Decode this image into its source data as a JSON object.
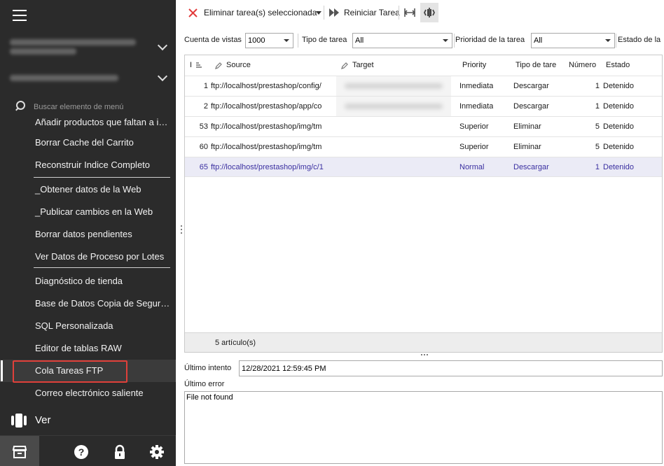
{
  "sidebar": {
    "search_placeholder": "Buscar elemento de menú",
    "menu_items": [
      "Añadir productos que faltan a inici",
      "Borrar Cache del Carrito",
      "Reconstruir Indice Completo",
      "_Obtener datos de la Web",
      "_Publicar cambios en la Web",
      "Borrar datos pendientes",
      "Ver Datos de Proceso por Lotes",
      "Diagnóstico de tienda",
      "Base de Datos Copia de Seguridad",
      "SQL Personalizada",
      "Editor de tablas RAW",
      "Cola Tareas FTP",
      "Correo electrónico saliente"
    ],
    "selected_item": "Cola Tareas FTP",
    "ver_label": "Ver",
    "bottom_icons": [
      "store-icon",
      "help-icon",
      "lock-icon",
      "gear-icon"
    ]
  },
  "toolbar": {
    "delete_label": "Eliminar tarea(s) seleccionada",
    "restart_label": "Reiniciar Tarea"
  },
  "filters": {
    "views_label": "Cuenta de vistas",
    "views_value": "1000",
    "task_type_label": "Tipo de tarea",
    "task_type_value": "All",
    "priority_label": "Prioridad de la tarea",
    "priority_value": "All",
    "status_label": "Estado de la"
  },
  "grid": {
    "columns": [
      "I",
      "Source",
      "Target",
      "Priority",
      "Tipo de tare",
      "Número",
      "Estado"
    ],
    "rows": [
      {
        "id": "1",
        "source": "ftp://localhost/prestashop/config/",
        "priority": "Inmediata",
        "type": "Descargar",
        "number": "1",
        "status": "Detenido"
      },
      {
        "id": "2",
        "source": "ftp://localhost/prestashop/app/co",
        "priority": "Inmediata",
        "type": "Descargar",
        "number": "1",
        "status": "Detenido"
      },
      {
        "id": "53",
        "source": "ftp://localhost/prestashop/img/tm",
        "priority": "Superior",
        "type": "Eliminar",
        "number": "5",
        "status": "Detenido"
      },
      {
        "id": "60",
        "source": "ftp://localhost/prestashop/img/tm",
        "priority": "Superior",
        "type": "Eliminar",
        "number": "5",
        "status": "Detenido"
      },
      {
        "id": "65",
        "source": "ftp://localhost/prestashop/img/c/1",
        "priority": "Normal",
        "type": "Descargar",
        "number": "1",
        "status": "Detenido"
      }
    ],
    "footer_count": "5 artículo(s)"
  },
  "details": {
    "last_attempt_label": "Último intento",
    "last_attempt_value": "12/28/2021 12:59:45 PM",
    "last_error_label": "Último error",
    "last_error_value": "File not found"
  },
  "colors": {
    "sidebar_bg": "#2b2b2b",
    "highlight": "#e0403a",
    "selected_row_text": "#3a2fa0",
    "delete_icon": "#e23b3b"
  }
}
